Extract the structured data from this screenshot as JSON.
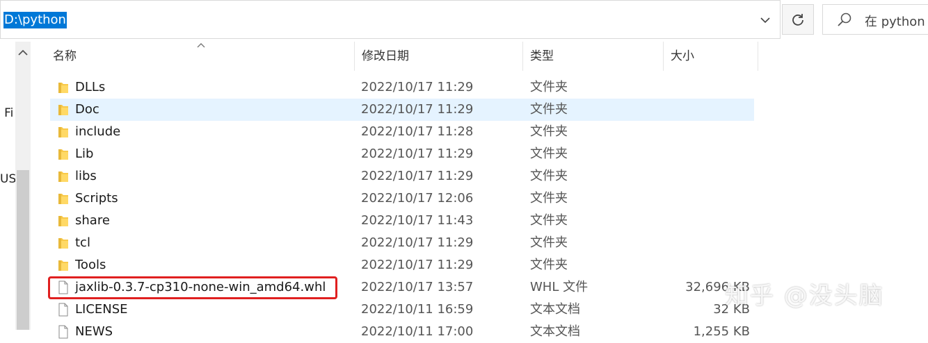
{
  "address": {
    "path": "D:\\python"
  },
  "search": {
    "placeholder": "在 python"
  },
  "nav": {
    "fragments": [
      "l Fi",
      "US"
    ]
  },
  "columns": {
    "name": "名称",
    "date": "修改日期",
    "type": "类型",
    "size": "大小"
  },
  "files": [
    {
      "name": "DLLs",
      "date": "2022/10/17 11:29",
      "type": "文件夹",
      "size": "",
      "icon": "folder-icon"
    },
    {
      "name": "Doc",
      "date": "2022/10/17 11:29",
      "type": "文件夹",
      "size": "",
      "icon": "folder-icon"
    },
    {
      "name": "include",
      "date": "2022/10/17 11:28",
      "type": "文件夹",
      "size": "",
      "icon": "folder-icon"
    },
    {
      "name": "Lib",
      "date": "2022/10/17 11:29",
      "type": "文件夹",
      "size": "",
      "icon": "folder-icon"
    },
    {
      "name": "libs",
      "date": "2022/10/17 11:29",
      "type": "文件夹",
      "size": "",
      "icon": "folder-icon"
    },
    {
      "name": "Scripts",
      "date": "2022/10/17 12:06",
      "type": "文件夹",
      "size": "",
      "icon": "folder-icon"
    },
    {
      "name": "share",
      "date": "2022/10/17 11:43",
      "type": "文件夹",
      "size": "",
      "icon": "folder-icon"
    },
    {
      "name": "tcl",
      "date": "2022/10/17 11:29",
      "type": "文件夹",
      "size": "",
      "icon": "folder-icon"
    },
    {
      "name": "Tools",
      "date": "2022/10/17 11:29",
      "type": "文件夹",
      "size": "",
      "icon": "folder-icon"
    },
    {
      "name": "jaxlib-0.3.7-cp310-none-win_amd64.whl",
      "date": "2022/10/17 13:57",
      "type": "WHL 文件",
      "size": "32,696 KB",
      "icon": "file-icon"
    },
    {
      "name": "LICENSE",
      "date": "2022/10/11 16:59",
      "type": "文本文档",
      "size": "32 KB",
      "icon": "file-icon"
    },
    {
      "name": "NEWS",
      "date": "2022/10/11 17:00",
      "type": "文本文档",
      "size": "1,255 KB",
      "icon": "file-icon"
    }
  ],
  "selected_index": 1,
  "highlighted_index": 9,
  "watermark": "知乎 @没头脑",
  "colors": {
    "selection_blue": "#0078d7",
    "row_hover": "#e5f3ff",
    "folder_yellow": "#f8c94a",
    "highlight_red": "#e02020"
  }
}
